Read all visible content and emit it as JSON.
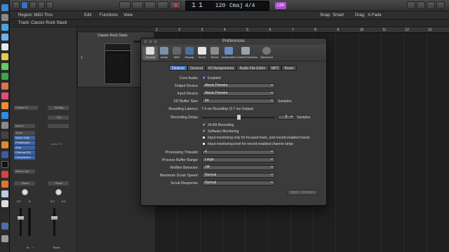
{
  "control_bar": {
    "lcd": {
      "bar": "1",
      "beat": "1",
      "tempo": "120",
      "key": "Cmaj",
      "time_sig": "4/4",
      "cpu": "c34"
    }
  },
  "header": {
    "region_label": "Region: MIDI Thru",
    "edit_menu": "Edit",
    "functions_menu": "Functions",
    "view_menu": "View",
    "snap_label": "Snap:",
    "snap_value": "Smart",
    "drag_label": "Drag:",
    "drag_value": "X-Fade",
    "track_label": "Track: Classic Rock Stack"
  },
  "inspector": {
    "left_strip": {
      "name": "Classic R...",
      "input": "Input 1",
      "plugins": [
        "Tuner",
        "Noise Gate",
        "Pedalboard",
        "Amp",
        "Channel EQ",
        "Compressor"
      ],
      "send": "Stereo Out",
      "mode": "Read",
      "pan_value": "0.0",
      "vol_value": "-5",
      "mute_solo": "M",
      "solo": "S",
      "bottom_label": "In",
      "bottom_r": "R"
    },
    "right_strip": {
      "setting": "Setting",
      "eq": "EQ",
      "input": "",
      "name": "Audio FX",
      "mode": "Read",
      "pan_value": "0.0",
      "vol_value": "0.0",
      "bottom_label": "Bnce"
    }
  },
  "tracklist": {
    "track_number": "1",
    "track_name": "Classic Rock Stack"
  },
  "ruler": {
    "bars": [
      "1",
      "2",
      "3",
      "4",
      "5",
      "6",
      "7",
      "8",
      "9",
      "10",
      "11",
      "12",
      "13"
    ]
  },
  "prefs": {
    "title": "Preferences",
    "toolbar": [
      "General",
      "Audio",
      "MIDI",
      "Display",
      "Score",
      "Movie",
      "Automation",
      "Control Surfaces",
      "Advanced"
    ],
    "tabs": [
      "Devices",
      "General",
      "I/O Assignments",
      "Audio File Editor",
      "MP3",
      "Reset"
    ],
    "active_tab": "Devices",
    "core_audio_label": "Core Audio:",
    "core_audio_checkbox": "Enabled",
    "output_device_label": "Output Device:",
    "output_device_value": "Alesis Firewire",
    "input_device_label": "Input Device:",
    "input_device_value": "Alesis Firewire",
    "buffer_label": "I/O Buffer Size:",
    "buffer_value": "64",
    "buffer_unit": "Samples",
    "latency_label": "Resulting Latency:",
    "latency_value": "7.4 ms Roundtrip (3.7 ms Output)",
    "rec_delay_label": "Recording Delay:",
    "rec_delay_value": "0",
    "rec_delay_unit": "Samples",
    "rec_delay_position": 0.5,
    "check_24bit": "24-Bit Recording",
    "check_sw_monitor": "Software Monitoring",
    "check_input_focused": "Input monitoring only for focused track, and record-enabled tracks",
    "check_input_level": "Input monitoring level for record-enabled channel strips",
    "threads_label": "Processing Threads:",
    "threads_value": "4",
    "buffer_range_label": "Process Buffer Range:",
    "buffer_range_value": "Large",
    "rewire_label": "ReWire Behavior:",
    "rewire_value": "Off",
    "scrub_speed_label": "Maximum Scrub Speed:",
    "scrub_speed_value": "Normal",
    "scrub_resp_label": "Scrub Response:",
    "scrub_resp_value": "Normal",
    "apply_button": "Apply Changes"
  },
  "colors": {
    "accent": "#3e6fc2",
    "lcd_bg": "#0d0f12",
    "cpu_badge": "#b04fd6"
  }
}
